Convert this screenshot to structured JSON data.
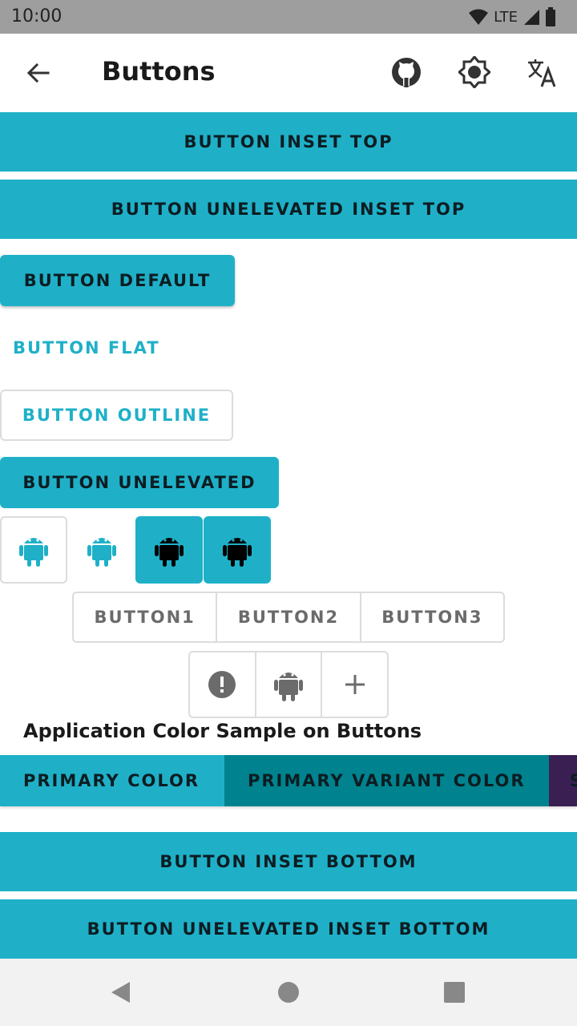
{
  "status_bar": {
    "time": "10:00",
    "network": "LTE"
  },
  "app_bar": {
    "title": "Buttons",
    "icons": [
      "back-arrow-icon",
      "github-icon",
      "brightness-icon",
      "translate-icon"
    ]
  },
  "buttons": {
    "inset_top": "BUTTON INSET TOP",
    "unelevated_inset_top": "BUTTON UNELEVATED INSET TOP",
    "default": "BUTTON DEFAULT",
    "flat": "BUTTON FLAT",
    "outline": "BUTTON OUTLINE",
    "unelevated": "BUTTON UNELEVATED",
    "inset_bottom": "BUTTON INSET BOTTOM",
    "unelevated_inset_bottom": "BUTTON UNELEVATED INSET BOTTOM"
  },
  "icon_buttons": [
    "android-icon",
    "android-icon",
    "android-icon",
    "android-icon"
  ],
  "toggle_group": {
    "items": [
      "BUTTON1",
      "BUTTON2",
      "BUTTON3"
    ]
  },
  "icon_toggle_group": {
    "icons": [
      "alert-icon",
      "android-icon",
      "plus-icon"
    ]
  },
  "color_section": {
    "title": "Application Color Sample on Buttons",
    "primary": "PRIMARY COLOR",
    "primary_variant": "PRIMARY VARIANT COLOR",
    "secondary_partial": "S"
  },
  "colors": {
    "primary": "#1fb0c8",
    "primary_variant": "#00838f",
    "secondary": "#3a1f52"
  },
  "nav_bar": {
    "icons": [
      "back-triangle-icon",
      "home-circle-icon",
      "recents-square-icon"
    ]
  }
}
